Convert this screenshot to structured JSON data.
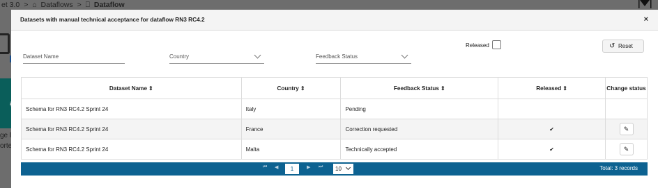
{
  "background": {
    "breadcrumb": [
      "et 3.0",
      ">",
      "Dataflows",
      ">",
      "Dataflow"
    ],
    "text1": "ge l",
    "text2": "orte"
  },
  "modal": {
    "title": "Datasets with manual technical acceptance for dataflow RN3 RC4.2",
    "close": "×"
  },
  "filters": {
    "dataset_name_placeholder": "Dataset Name",
    "country_placeholder": "Country",
    "feedback_status_placeholder": "Feedback Status",
    "released_label": "Released",
    "reset_label": "Reset"
  },
  "table": {
    "headers": {
      "dataset_name": "Dataset Name",
      "country": "Country",
      "feedback_status": "Feedback Status",
      "released": "Released",
      "change_status": "Change status"
    },
    "rows": [
      {
        "dataset_name": "Schema for RN3 RC4.2 Sprint 24",
        "country": "Italy",
        "feedback_status": "Pending",
        "released": "",
        "editable": false
      },
      {
        "dataset_name": "Schema for RN3 RC4.2 Sprint 24",
        "country": "France",
        "feedback_status": "Correction requested",
        "released": "✔",
        "editable": true
      },
      {
        "dataset_name": "Schema for RN3 RC4.2 Sprint 24",
        "country": "Malta",
        "feedback_status": "Technically accepted",
        "released": "✔",
        "editable": true
      }
    ]
  },
  "paginator": {
    "current_page": "1",
    "rows_per_page": "10",
    "total": "Total: 3 records"
  },
  "colors": {
    "paginator_bg": "#0d6291",
    "overlay_bg": "#6d6d6d"
  }
}
